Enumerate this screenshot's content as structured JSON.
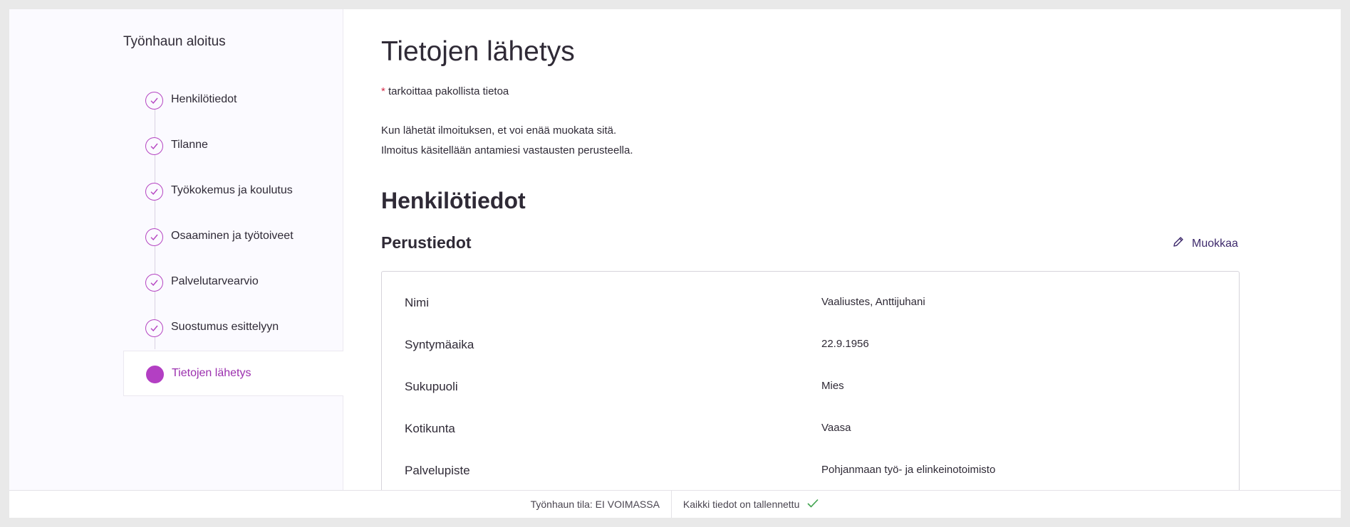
{
  "sidebar": {
    "title": "Työnhaun aloitus",
    "steps": [
      {
        "label": "Henkilötiedot",
        "status": "done"
      },
      {
        "label": "Tilanne",
        "status": "done"
      },
      {
        "label": "Työkokemus ja koulutus",
        "status": "done"
      },
      {
        "label": "Osaaminen ja työtoiveet",
        "status": "done"
      },
      {
        "label": "Palvelutarvearvio",
        "status": "done"
      },
      {
        "label": "Suostumus esittelyyn",
        "status": "done"
      },
      {
        "label": "Tietojen lähetys",
        "status": "active"
      }
    ]
  },
  "main": {
    "title": "Tietojen lähetys",
    "required_star": "*",
    "required_text": " tarkoittaa pakollista tietoa",
    "info_line1": "Kun lähetät ilmoituksen, et voi enää muokata sitä.",
    "info_line2": "Ilmoitus käsitellään antamiesi vastausten perusteella.",
    "section_title": "Henkilötiedot",
    "subsection_title": "Perustiedot",
    "edit_label": "Muokkaa",
    "fields": [
      {
        "label": "Nimi",
        "value": "Vaaliustes, Anttijuhani"
      },
      {
        "label": "Syntymäaika",
        "value": "22.9.1956"
      },
      {
        "label": "Sukupuoli",
        "value": "Mies"
      },
      {
        "label": "Kotikunta",
        "value": "Vaasa"
      },
      {
        "label": "Palvelupiste",
        "value": "Pohjanmaan työ- ja elinkeinotoimisto"
      }
    ]
  },
  "footer": {
    "status": "Työnhaun tila: EI VOIMASSA",
    "saved": "Kaikki tiedot on tallennettu"
  },
  "colors": {
    "accent": "#b33fc3",
    "required": "#d42d4a",
    "saved_check": "#3fa34d"
  }
}
